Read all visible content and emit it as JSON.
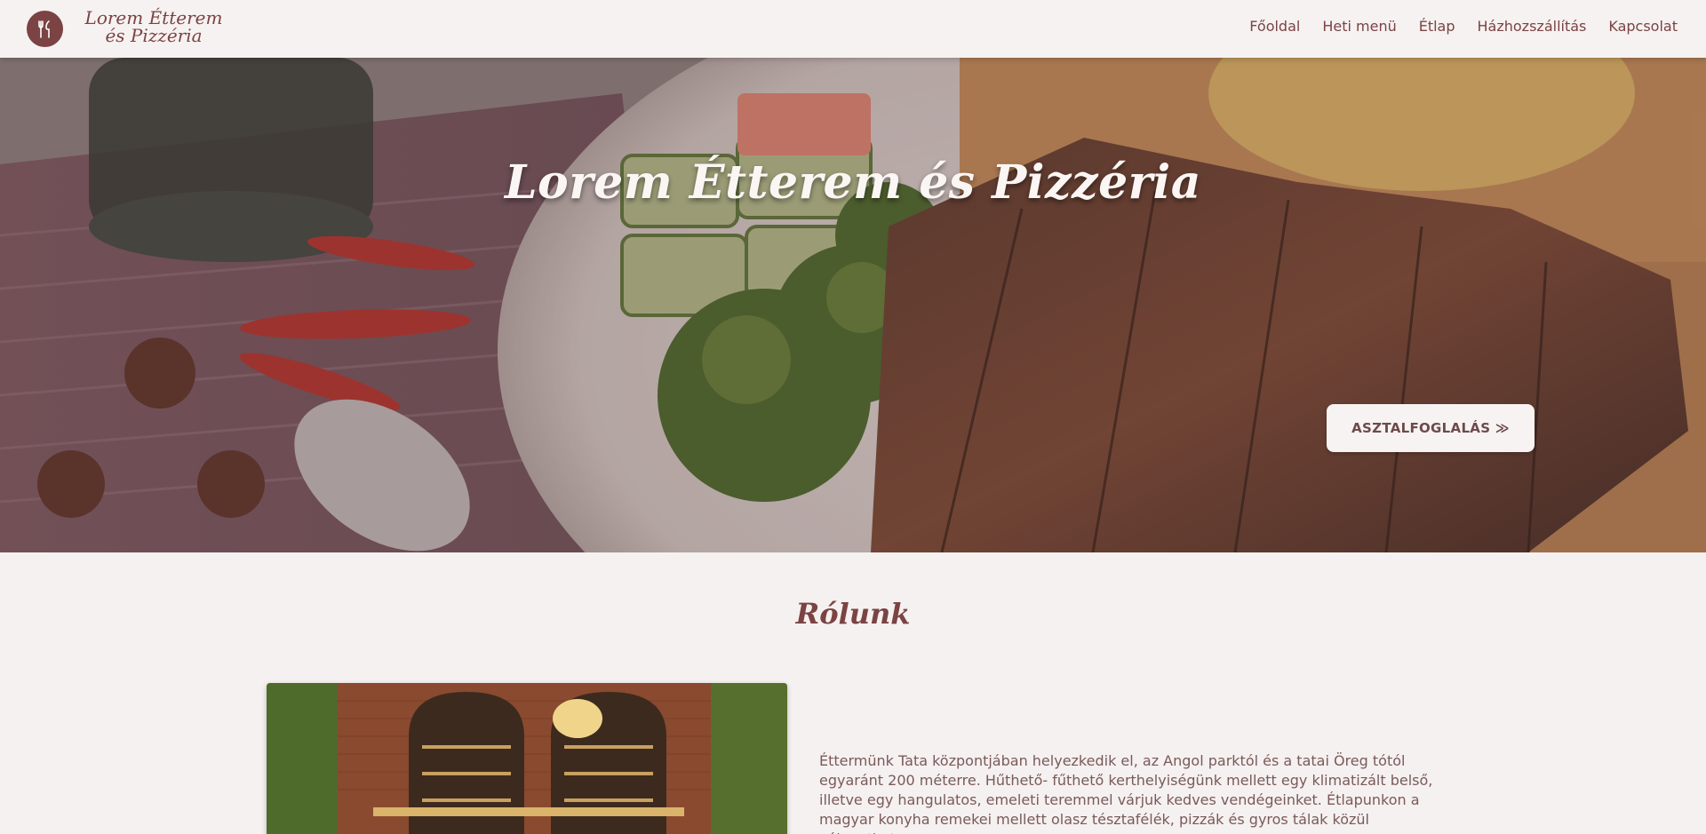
{
  "brand": {
    "name": "Lorem Étterem és Pizzéria",
    "logo_icon": "fork-knife-icon"
  },
  "nav": {
    "items": [
      {
        "label": "Főoldal"
      },
      {
        "label": "Heti menü"
      },
      {
        "label": "Étlap"
      },
      {
        "label": "Házhozszállítás"
      },
      {
        "label": "Kapcsolat"
      }
    ]
  },
  "hero": {
    "title": "Lorem Étterem és Pizzéria",
    "button_label": "ASZTALFOGLALÁS ≫"
  },
  "about": {
    "title": "Rólunk",
    "text": "Éttermünk Tata központjában helyezkedik el, az Angol parktól és a tatai Öreg tótól egyaránt 200 méterre. Hűthető- fűthető kerthelyiségünk mellett egy klimatizált belső, illetve egy hangulatos, emeleti teremmel várjuk kedves vendégeinket. Étlapunkon a magyar konyha remekei mellett olasz tésztafélék, pizzák és gyros tálak közül válogathat."
  },
  "colors": {
    "accent": "#7b4343",
    "background": "#f5f1f0",
    "text": "#7a5a5a"
  }
}
